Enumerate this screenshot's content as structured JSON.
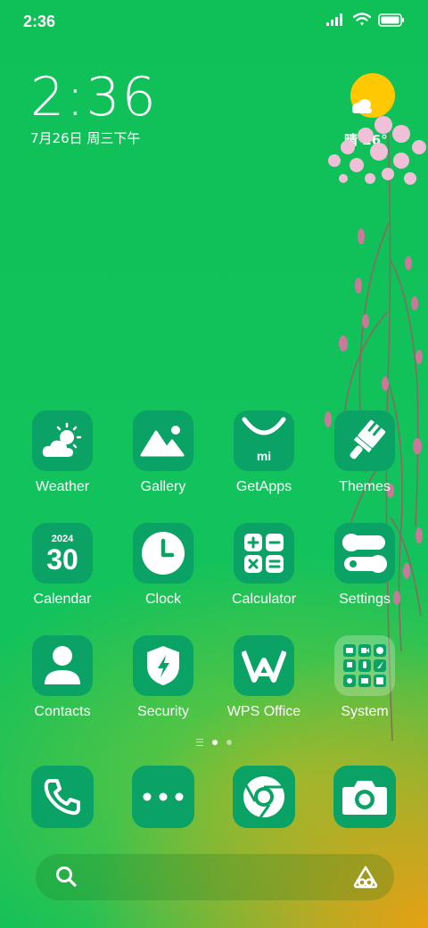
{
  "status_bar": {
    "time": "2:36"
  },
  "clock_widget": {
    "time": "2:36",
    "date": "7月26日 周三下午"
  },
  "weather_widget": {
    "text": "晴 26°"
  },
  "apps": [
    {
      "label": "Weather",
      "icon": "weather-icon"
    },
    {
      "label": "Gallery",
      "icon": "gallery-icon"
    },
    {
      "label": "GetApps",
      "icon": "getapps-icon",
      "icon_text": "mi"
    },
    {
      "label": "Themes",
      "icon": "themes-brush-icon"
    },
    {
      "label": "Calendar",
      "icon": "calendar-icon",
      "year": "2024",
      "day": "30"
    },
    {
      "label": "Clock",
      "icon": "clock-icon"
    },
    {
      "label": "Calculator",
      "icon": "calculator-icon"
    },
    {
      "label": "Settings",
      "icon": "settings-toggle-icon"
    },
    {
      "label": "Contacts",
      "icon": "contacts-icon"
    },
    {
      "label": "Security",
      "icon": "security-shield-icon"
    },
    {
      "label": "WPS Office",
      "icon": "wps-office-icon"
    },
    {
      "label": "System",
      "icon": "system-folder-icon"
    }
  ],
  "dock": [
    {
      "name": "phone",
      "icon": "phone-icon"
    },
    {
      "name": "more",
      "icon": "more-dots-icon"
    },
    {
      "name": "chrome",
      "icon": "chrome-icon"
    },
    {
      "name": "camera",
      "icon": "camera-icon"
    }
  ],
  "page_indicator": {
    "pages": 2,
    "current": 1
  },
  "search_bar": {
    "left_icon": "search-icon",
    "right_icon": "assistant-icon"
  },
  "colors": {
    "tile": "#0ba365",
    "background": "#12c25c",
    "accent_sun": "#ffc800"
  }
}
